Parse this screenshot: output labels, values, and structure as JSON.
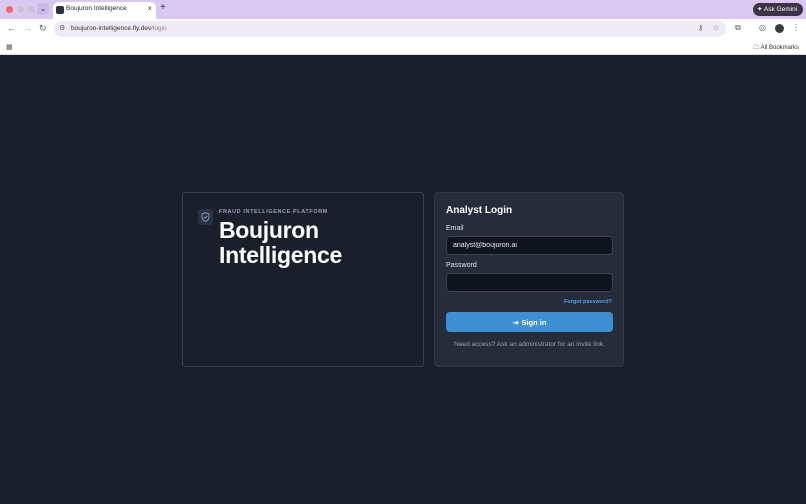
{
  "browser": {
    "tab_title": "Boujuron Intelligence",
    "tab_close": "×",
    "new_tab": "+",
    "ask_gemini": "Ask Gemini",
    "url_host": "boujuron-intelligence.fly.dev",
    "url_path": "/login",
    "all_bookmarks": "All Bookmarks"
  },
  "brand": {
    "eyebrow": "FRAUD INTELLIGENCE PLATFORM",
    "title": "Boujuron Intelligence",
    "icon": "shield-check-icon"
  },
  "login": {
    "title": "Analyst Login",
    "email_label": "Email",
    "email_value": "analyst@boujuron.ai",
    "password_label": "Password",
    "password_value": "",
    "forgot_link": "Forgot password?",
    "signin_label": "Sign in",
    "access_note": "Need access? Ask an administrator for an invite link."
  },
  "colors": {
    "background": "#1a1e2b",
    "accent": "#3e8fd3",
    "link": "#4aa3ea",
    "tabbar": "#d9c8f1"
  }
}
